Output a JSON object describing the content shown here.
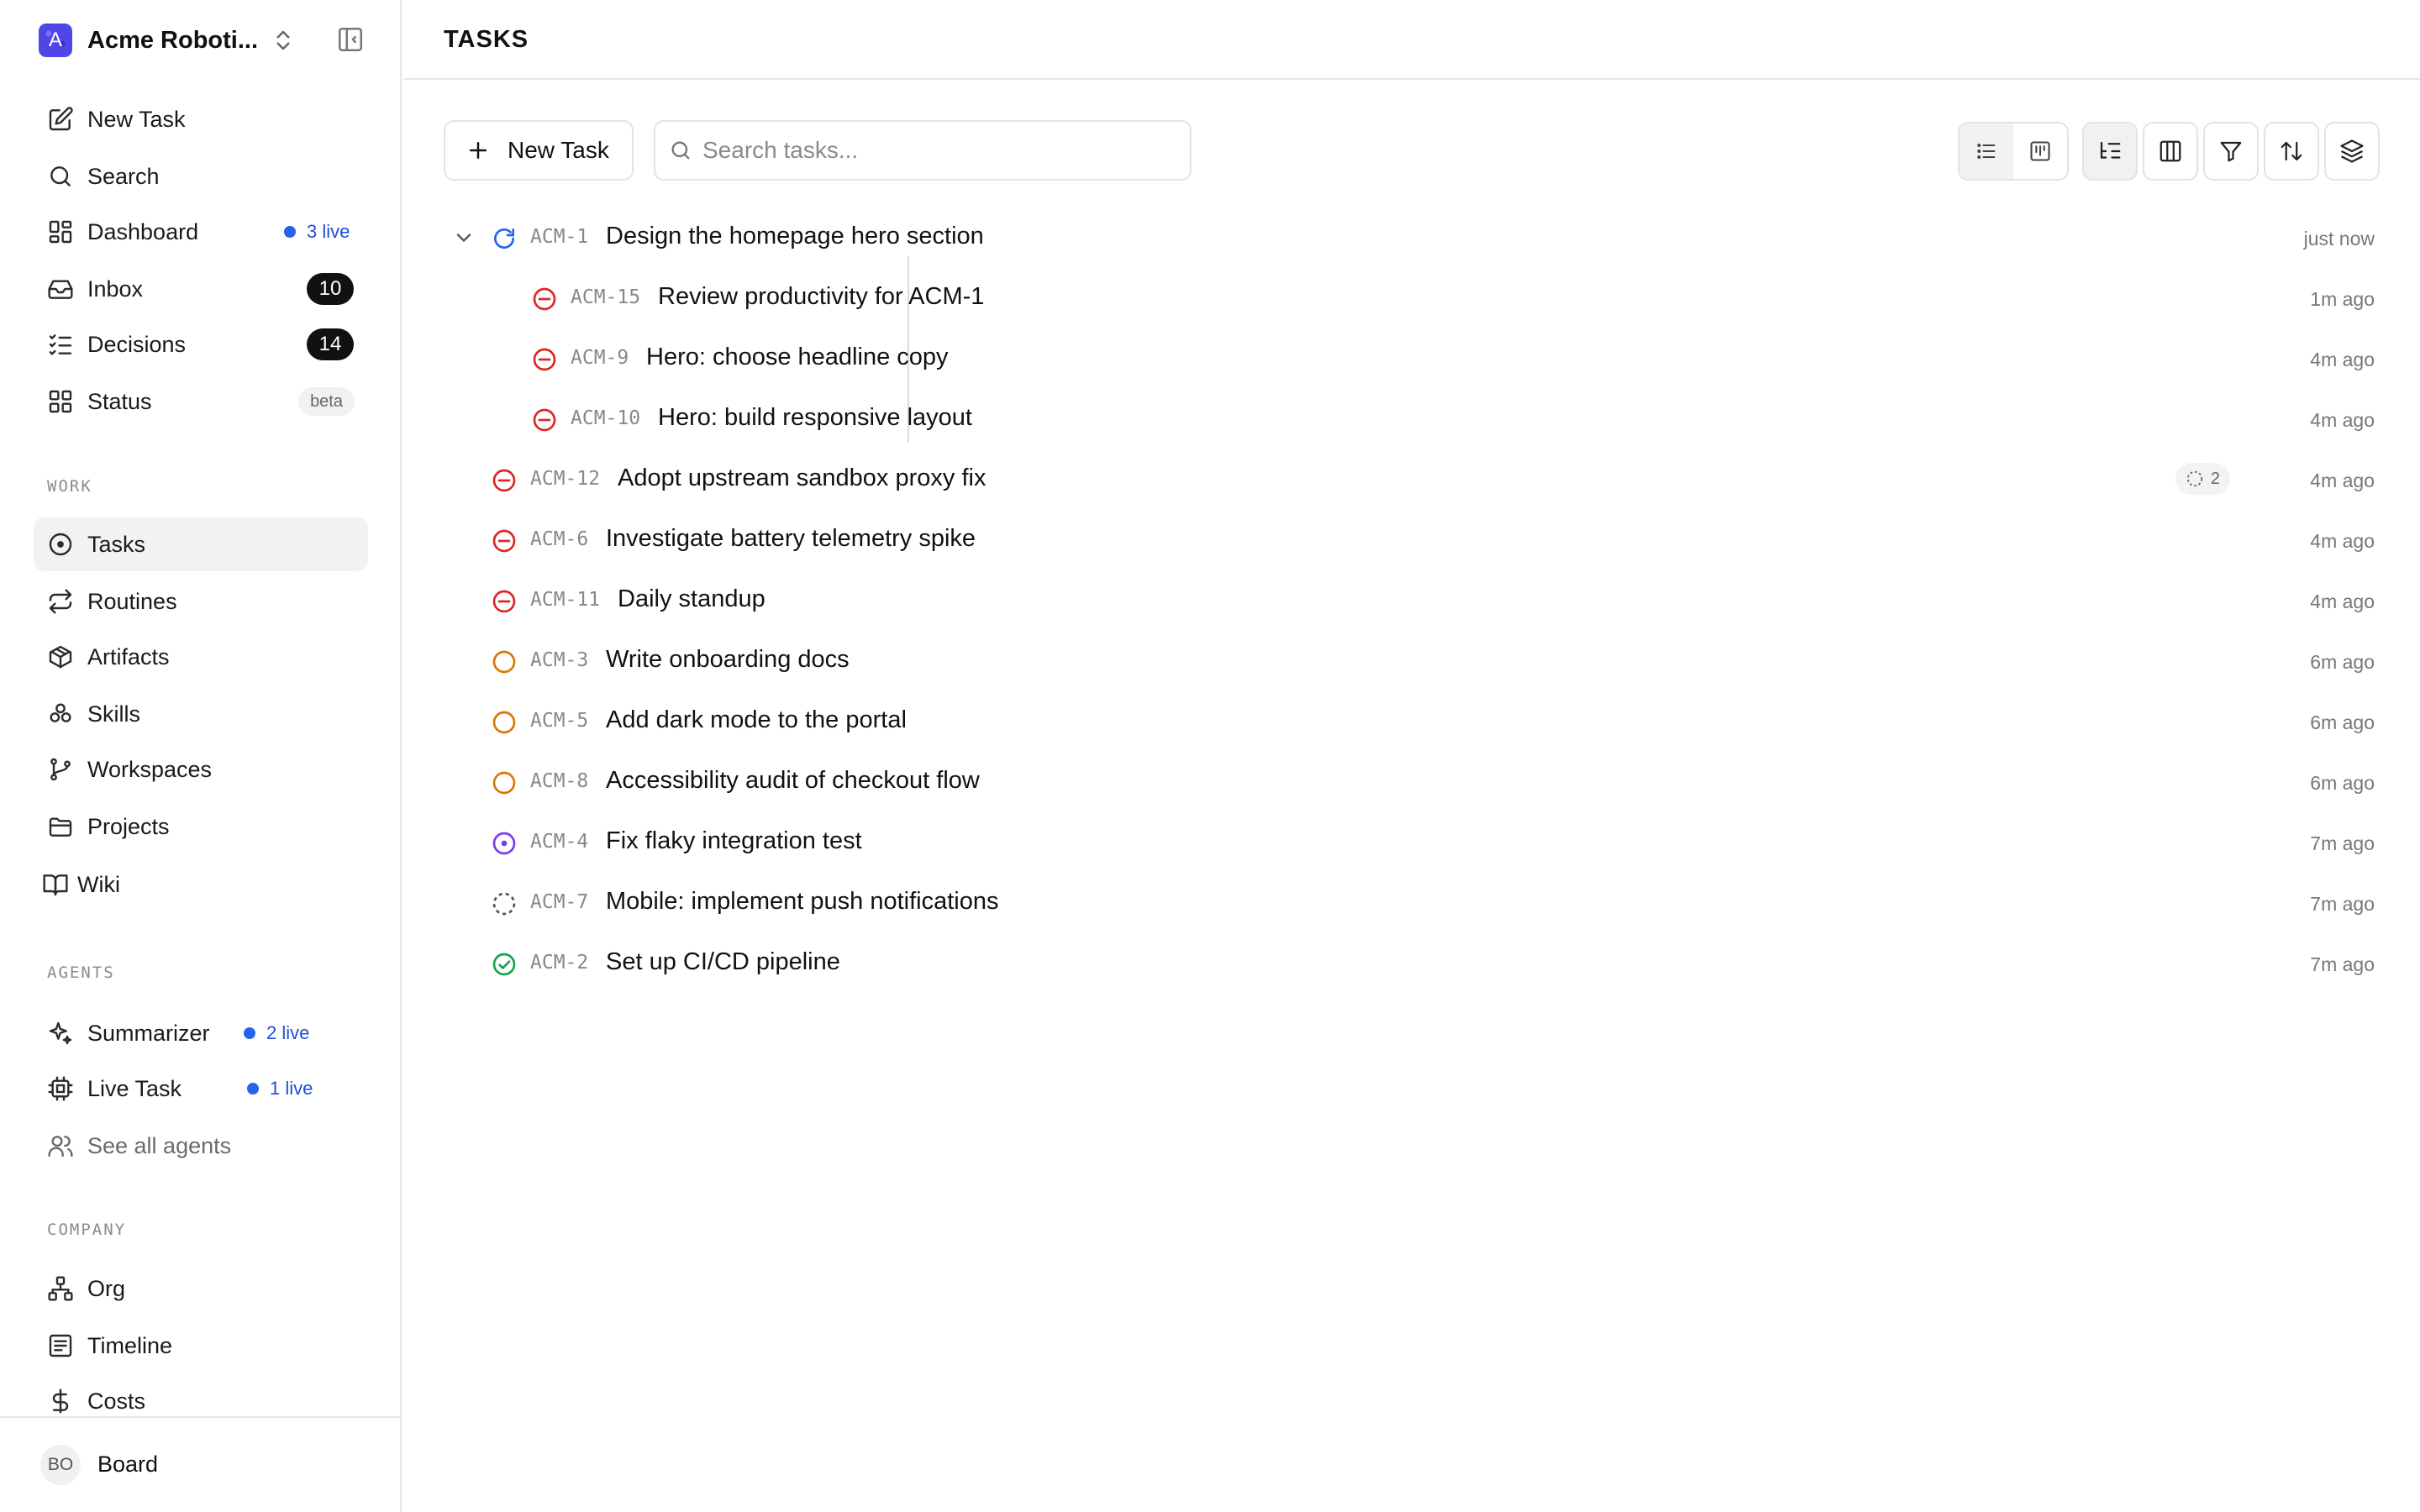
{
  "workspace": {
    "name": "Acme Roboti...",
    "initial": "A"
  },
  "nav_primary": [
    {
      "label": "New Task",
      "icon": "edit-icon"
    },
    {
      "label": "Search",
      "icon": "search-icon"
    },
    {
      "label": "Dashboard",
      "icon": "dashboard-icon",
      "live": "3 live"
    },
    {
      "label": "Inbox",
      "icon": "inbox-icon",
      "count": "10"
    },
    {
      "label": "Decisions",
      "icon": "checklist-icon",
      "count": "14"
    },
    {
      "label": "Status",
      "icon": "grid-icon",
      "tag": "beta"
    }
  ],
  "sections": {
    "work": "WORK",
    "agents": "AGENTS",
    "company": "COMPANY"
  },
  "nav_work": [
    {
      "label": "Tasks",
      "icon": "target-icon",
      "active": true
    },
    {
      "label": "Routines",
      "icon": "repeat-icon"
    },
    {
      "label": "Artifacts",
      "icon": "box-icon"
    },
    {
      "label": "Skills",
      "icon": "skills-icon"
    },
    {
      "label": "Workspaces",
      "icon": "branch-icon"
    },
    {
      "label": "Projects",
      "icon": "folder-icon"
    },
    {
      "label": "Wiki",
      "icon": "book-icon"
    }
  ],
  "nav_agents": [
    {
      "label": "Summarizer",
      "icon": "sparkle-icon",
      "live": "2 live"
    },
    {
      "label": "Live Task",
      "icon": "chip-icon",
      "live": "1 live"
    },
    {
      "label": "See all agents",
      "icon": "users-icon"
    }
  ],
  "nav_company": [
    {
      "label": "Org",
      "icon": "org-icon"
    },
    {
      "label": "Timeline",
      "icon": "timeline-icon"
    },
    {
      "label": "Costs",
      "icon": "dollar-icon"
    }
  ],
  "user": {
    "initials": "BO",
    "name": "Board"
  },
  "page": {
    "title": "TASKS"
  },
  "toolbar": {
    "new_task_label": "New Task",
    "search_placeholder": "Search tasks..."
  },
  "colors": {
    "blocked": "#dc2626",
    "todo": "#d97706",
    "in_review": "#7c3aed",
    "done": "#16a34a",
    "in_progress": "#2563eb",
    "backlog": "#555555",
    "live": "#2563eb"
  },
  "tasks": [
    {
      "id": "ACM-1",
      "title": "Design the homepage hero section",
      "status": "in_progress",
      "ago": "just now",
      "expanded": true
    },
    {
      "id": "ACM-15",
      "title": "Review productivity for ACM-1",
      "status": "blocked",
      "ago": "1m ago",
      "child": true
    },
    {
      "id": "ACM-9",
      "title": "Hero: choose headline copy",
      "status": "blocked",
      "ago": "4m ago",
      "child": true
    },
    {
      "id": "ACM-10",
      "title": "Hero: build responsive layout",
      "status": "blocked",
      "ago": "4m ago",
      "child": true
    },
    {
      "id": "ACM-12",
      "title": "Adopt upstream sandbox proxy fix",
      "status": "blocked",
      "ago": "4m ago",
      "subtasks": "2"
    },
    {
      "id": "ACM-6",
      "title": "Investigate battery telemetry spike",
      "status": "blocked",
      "ago": "4m ago"
    },
    {
      "id": "ACM-11",
      "title": "Daily standup",
      "status": "blocked",
      "ago": "4m ago"
    },
    {
      "id": "ACM-3",
      "title": "Write onboarding docs",
      "status": "todo",
      "ago": "6m ago"
    },
    {
      "id": "ACM-5",
      "title": "Add dark mode to the portal",
      "status": "todo",
      "ago": "6m ago"
    },
    {
      "id": "ACM-8",
      "title": "Accessibility audit of checkout flow",
      "status": "todo",
      "ago": "6m ago"
    },
    {
      "id": "ACM-4",
      "title": "Fix flaky integration test",
      "status": "in_review",
      "ago": "7m ago"
    },
    {
      "id": "ACM-7",
      "title": "Mobile: implement push notifications",
      "status": "backlog",
      "ago": "7m ago"
    },
    {
      "id": "ACM-2",
      "title": "Set up CI/CD pipeline",
      "status": "done",
      "ago": "7m ago"
    }
  ]
}
